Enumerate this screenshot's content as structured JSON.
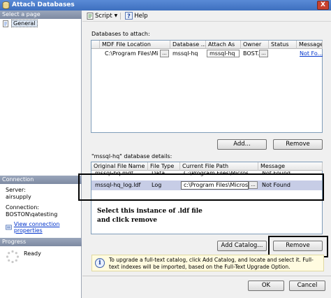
{
  "window": {
    "title": "Attach Databases",
    "close_glyph": "X"
  },
  "left_pane": {
    "select_page_header": "Select a page",
    "pages": [
      {
        "label": "General",
        "icon": "page-icon"
      }
    ],
    "connection_header": "Connection",
    "server_label": "Server:",
    "server_value": "airsupply",
    "connection_label": "Connection:",
    "connection_value": "BOSTON\\qatesting",
    "view_connection_link": "View connection properties",
    "progress_header": "Progress",
    "progress_status": "Ready"
  },
  "toolbar": {
    "script_label": "Script",
    "help_label": "Help"
  },
  "databases": {
    "section_label": "Databases to attach:",
    "columns": [
      "MDF File Location",
      "Database ...",
      "Attach As",
      "Owner",
      "Status",
      "Message"
    ],
    "rows": [
      {
        "mdf": "C:\\Program Files\\Mi...",
        "dbname": "mssql-hq",
        "attach_as": "mssql-hq",
        "owner": "BOST...",
        "status": "",
        "message": "Not Fo..."
      }
    ],
    "add_button": "Add...",
    "remove_button": "Remove"
  },
  "details": {
    "section_label": "\"mssql-hq\" database details:",
    "columns": [
      "Original File Name",
      "File Type",
      "Current File Path",
      "Message"
    ],
    "rows": [
      {
        "name": "mssql-hq.mdf",
        "type": "Data",
        "path": "C:\\Program Files\\Micros...",
        "message": "Not Found"
      },
      {
        "name": "mssql-hq_log.ldf",
        "type": "Log",
        "path": "c:\\Program Files\\Microsoft S",
        "message": "Not Found"
      }
    ],
    "add_catalog_button": "Add Catalog...",
    "remove_button": "Remove"
  },
  "annotation": {
    "line1": "Select this instance of .ldf file",
    "line2": "and click remove"
  },
  "info": {
    "text": "To upgrade a full-text catalog, click Add Catalog, and locate and select it. Full-text indexes will be imported, based on the Full-Text Upgrade Option."
  },
  "dialog": {
    "ok_button": "OK",
    "cancel_button": "Cancel"
  },
  "colors": {
    "title_bar": "#3d6fbf",
    "left_header": "#8794ac",
    "selected_row": "#c7cde6",
    "link": "#0033cc"
  }
}
